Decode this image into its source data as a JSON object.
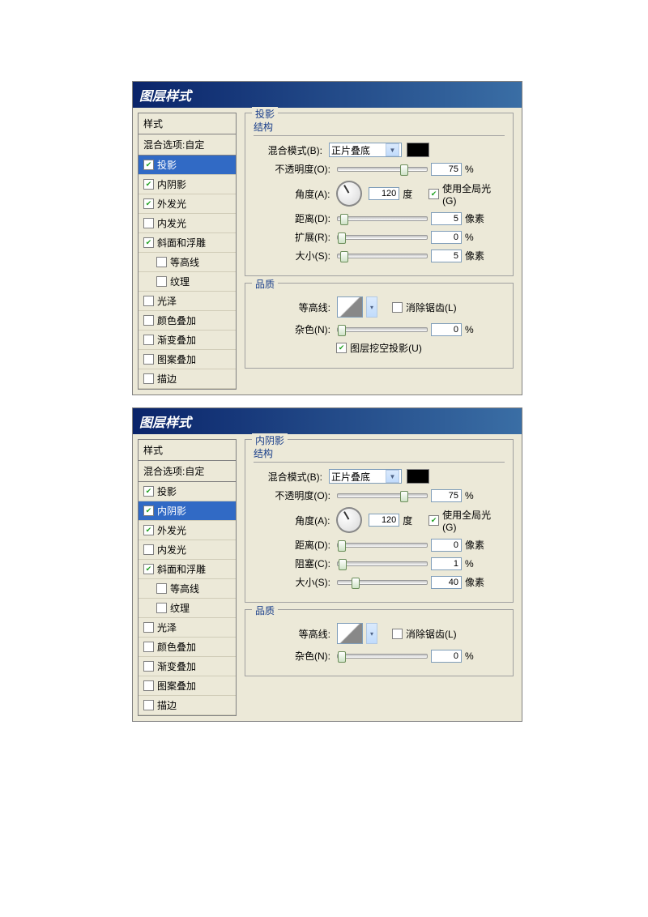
{
  "dialogs": [
    {
      "title": "图层样式",
      "stylesHeader": "样式",
      "blendOpt": "混合选项:自定",
      "effects": [
        {
          "label": "投影",
          "checked": true,
          "selected": true
        },
        {
          "label": "内阴影",
          "checked": true
        },
        {
          "label": "外发光",
          "checked": true
        },
        {
          "label": "内发光",
          "checked": false
        },
        {
          "label": "斜面和浮雕",
          "checked": true
        },
        {
          "label": "等高线",
          "checked": false,
          "sub": true
        },
        {
          "label": "纹理",
          "checked": false,
          "sub": true
        },
        {
          "label": "光泽",
          "checked": false
        },
        {
          "label": "颜色叠加",
          "checked": false
        },
        {
          "label": "渐变叠加",
          "checked": false
        },
        {
          "label": "图案叠加",
          "checked": false
        },
        {
          "label": "描边",
          "checked": false
        }
      ],
      "panel": {
        "title": "投影",
        "structure": "结构",
        "blendMode": {
          "label": "混合模式(B):",
          "value": "正片叠底"
        },
        "opacity": {
          "label": "不透明度(O):",
          "value": "75",
          "unit": "%",
          "pos": 70
        },
        "angle": {
          "label": "角度(A):",
          "value": "120",
          "unit": "度",
          "globalLabel": "使用全局光(G)",
          "global": true
        },
        "distance": {
          "label": "距离(D):",
          "value": "5",
          "unit": "像素",
          "pos": 3
        },
        "spread": {
          "label": "扩展(R):",
          "value": "0",
          "unit": "%",
          "pos": 0
        },
        "size": {
          "label": "大小(S):",
          "value": "5",
          "unit": "像素",
          "pos": 3
        },
        "quality": "品质",
        "contour": {
          "label": "等高线:",
          "antiLabel": "消除锯齿(L)",
          "anti": false
        },
        "noise": {
          "label": "杂色(N):",
          "value": "0",
          "unit": "%",
          "pos": 0
        },
        "knockout": {
          "label": "图层挖空投影(U)",
          "checked": true
        }
      }
    },
    {
      "title": "图层样式",
      "stylesHeader": "样式",
      "blendOpt": "混合选项:自定",
      "effects": [
        {
          "label": "投影",
          "checked": true
        },
        {
          "label": "内阴影",
          "checked": true,
          "selected": true
        },
        {
          "label": "外发光",
          "checked": true
        },
        {
          "label": "内发光",
          "checked": false
        },
        {
          "label": "斜面和浮雕",
          "checked": true
        },
        {
          "label": "等高线",
          "checked": false,
          "sub": true
        },
        {
          "label": "纹理",
          "checked": false,
          "sub": true
        },
        {
          "label": "光泽",
          "checked": false
        },
        {
          "label": "颜色叠加",
          "checked": false
        },
        {
          "label": "渐变叠加",
          "checked": false
        },
        {
          "label": "图案叠加",
          "checked": false
        },
        {
          "label": "描边",
          "checked": false
        }
      ],
      "panel": {
        "title": "内阴影",
        "structure": "结构",
        "blendMode": {
          "label": "混合模式(B):",
          "value": "正片叠底"
        },
        "opacity": {
          "label": "不透明度(O):",
          "value": "75",
          "unit": "%",
          "pos": 70
        },
        "angle": {
          "label": "角度(A):",
          "value": "120",
          "unit": "度",
          "globalLabel": "使用全局光(G)",
          "global": true
        },
        "distance": {
          "label": "距离(D):",
          "value": "0",
          "unit": "像素",
          "pos": 0
        },
        "spread": {
          "label": "阻塞(C):",
          "value": "1",
          "unit": "%",
          "pos": 1
        },
        "size": {
          "label": "大小(S):",
          "value": "40",
          "unit": "像素",
          "pos": 15
        },
        "quality": "品质",
        "contour": {
          "label": "等高线:",
          "antiLabel": "消除锯齿(L)",
          "anti": false
        },
        "noise": {
          "label": "杂色(N):",
          "value": "0",
          "unit": "%",
          "pos": 0
        }
      }
    }
  ]
}
